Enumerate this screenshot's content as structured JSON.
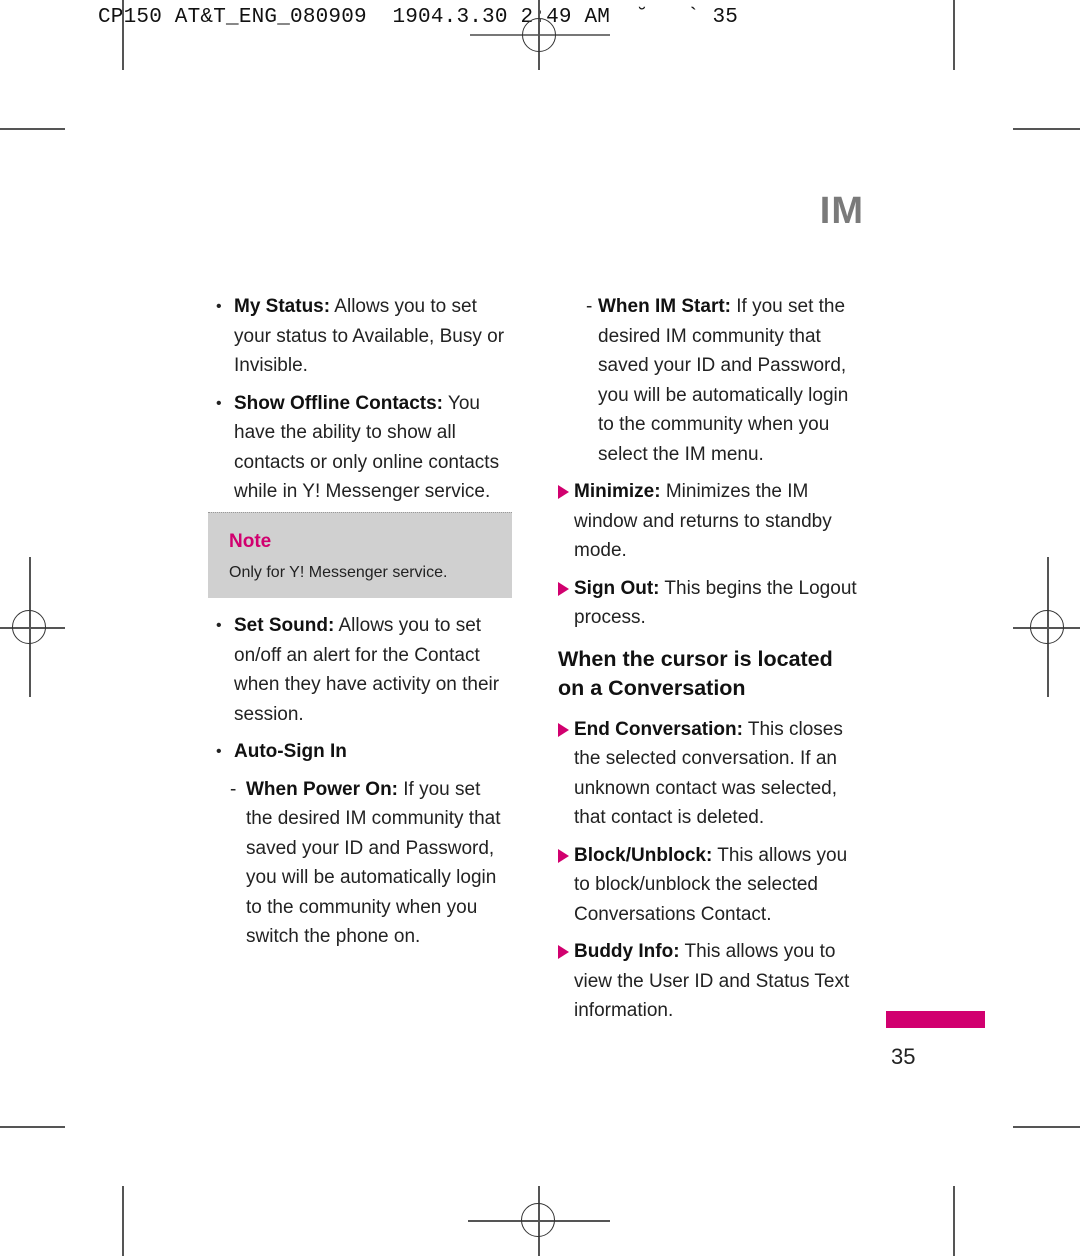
{
  "print_header": "CP150 AT&T_ENG_080909  1904.3.30 2:49 AM  ˘   ` 35",
  "section_title": "IM",
  "left_column": {
    "items": [
      {
        "label": "My Status:",
        "text": " Allows you to set your status to Available, Busy or Invisible."
      },
      {
        "label": "Show Offline Contacts:",
        "text": " You have the ability to show all contacts or only online contacts while in Y! Messenger service."
      }
    ],
    "note": {
      "title": "Note",
      "text": "Only for Y! Messenger service."
    },
    "items_after_note": [
      {
        "label": "Set Sound:",
        "text": " Allows you to set on/off an alert for the Contact when they have activity on their session."
      },
      {
        "label": "Auto-Sign In",
        "text": ""
      }
    ],
    "sub_items": [
      {
        "label": "When Power On:",
        "text": " If you set the desired IM community that saved your ID and Password, you will be automatically login to the community when you switch the phone on."
      }
    ]
  },
  "right_column": {
    "sub_items": [
      {
        "label": "When IM Start:",
        "text": " If you set the desired IM community that saved your ID and Password, you will be automatically login to the community when you select the IM menu."
      }
    ],
    "items": [
      {
        "label": "Minimize:",
        "text": " Minimizes the IM window and returns to standby mode."
      },
      {
        "label": "Sign Out:",
        "text": " This begins the Logout process."
      }
    ],
    "subheading": "When the cursor is located on a Conversation",
    "conversation_items": [
      {
        "label": "End Conversation:",
        "text": " This closes the selected conversation. If an unknown contact was selected, that contact is deleted."
      },
      {
        "label": "Block/Unblock:",
        "text": " This allows you to block/unblock the selected Conversations Contact."
      },
      {
        "label": "Buddy Info:",
        "text": " This allows you to view the User ID and Status Text information."
      }
    ]
  },
  "page_number": "35",
  "colors": {
    "accent": "#d1006f",
    "note_background": "#d0d0d0",
    "section_title": "#7a7a7a"
  }
}
